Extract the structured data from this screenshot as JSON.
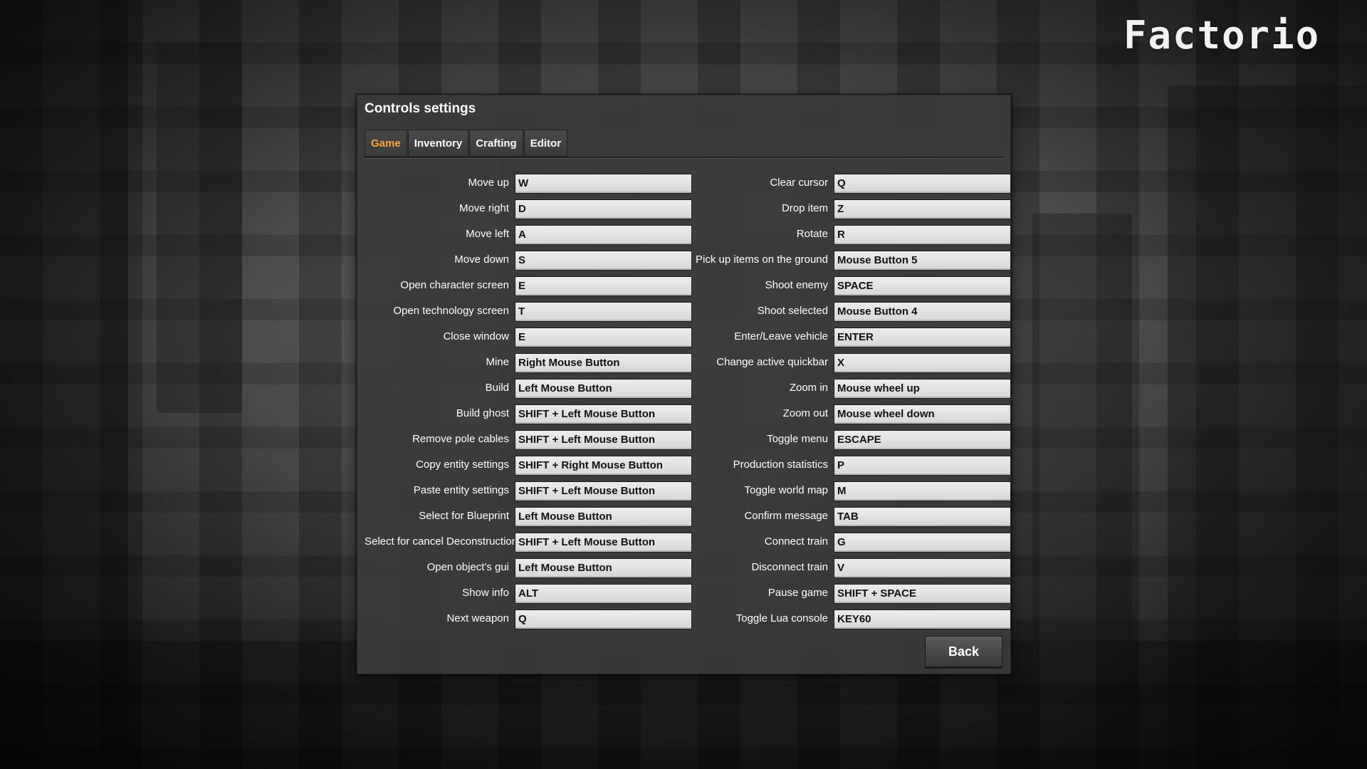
{
  "logo": {
    "text": "Factorio"
  },
  "dialog": {
    "title": "Controls settings",
    "tabs": [
      {
        "label": "Game",
        "active": true
      },
      {
        "label": "Inventory",
        "active": false
      },
      {
        "label": "Crafting",
        "active": false
      },
      {
        "label": "Editor",
        "active": false
      }
    ],
    "left_bindings": [
      {
        "label": "Move up",
        "key": "W"
      },
      {
        "label": "Move right",
        "key": "D"
      },
      {
        "label": "Move left",
        "key": "A"
      },
      {
        "label": "Move down",
        "key": "S"
      },
      {
        "label": "Open character screen",
        "key": "E"
      },
      {
        "label": "Open technology screen",
        "key": "T"
      },
      {
        "label": "Close window",
        "key": "E"
      },
      {
        "label": "Mine",
        "key": "Right Mouse Button"
      },
      {
        "label": "Build",
        "key": "Left Mouse Button"
      },
      {
        "label": "Build ghost",
        "key": "SHIFT + Left Mouse Button"
      },
      {
        "label": "Remove pole cables",
        "key": "SHIFT + Left Mouse Button"
      },
      {
        "label": "Copy entity settings",
        "key": "SHIFT + Right Mouse Button"
      },
      {
        "label": "Paste entity settings",
        "key": "SHIFT + Left Mouse Button"
      },
      {
        "label": "Select for Blueprint",
        "key": "Left Mouse Button"
      },
      {
        "label": "Select for cancel Deconstruction",
        "key": "SHIFT + Left Mouse Button"
      },
      {
        "label": "Open object's gui",
        "key": "Left Mouse Button"
      },
      {
        "label": "Show info",
        "key": "ALT"
      },
      {
        "label": "Next weapon",
        "key": "Q"
      }
    ],
    "right_bindings": [
      {
        "label": "Clear cursor",
        "key": "Q"
      },
      {
        "label": "Drop item",
        "key": "Z"
      },
      {
        "label": "Rotate",
        "key": "R"
      },
      {
        "label": "Pick up items on the ground",
        "key": "Mouse Button 5"
      },
      {
        "label": "Shoot enemy",
        "key": "SPACE"
      },
      {
        "label": "Shoot selected",
        "key": "Mouse Button 4"
      },
      {
        "label": "Enter/Leave vehicle",
        "key": "ENTER"
      },
      {
        "label": "Change active quickbar",
        "key": "X"
      },
      {
        "label": "Zoom in",
        "key": "Mouse wheel up"
      },
      {
        "label": "Zoom out",
        "key": "Mouse wheel down"
      },
      {
        "label": "Toggle menu",
        "key": "ESCAPE"
      },
      {
        "label": "Production statistics",
        "key": "P"
      },
      {
        "label": "Toggle world map",
        "key": "M"
      },
      {
        "label": "Confirm message",
        "key": "TAB"
      },
      {
        "label": "Connect train",
        "key": "G"
      },
      {
        "label": "Disconnect train",
        "key": "V"
      },
      {
        "label": "Pause game",
        "key": "SHIFT + SPACE"
      },
      {
        "label": "Toggle Lua console",
        "key": "KEY60"
      }
    ],
    "back_label": "Back"
  },
  "colors": {
    "active_tab": "#ffa53a",
    "panel_bg": "#3a3a3a",
    "key_field_bg": "#e0e0e0"
  }
}
